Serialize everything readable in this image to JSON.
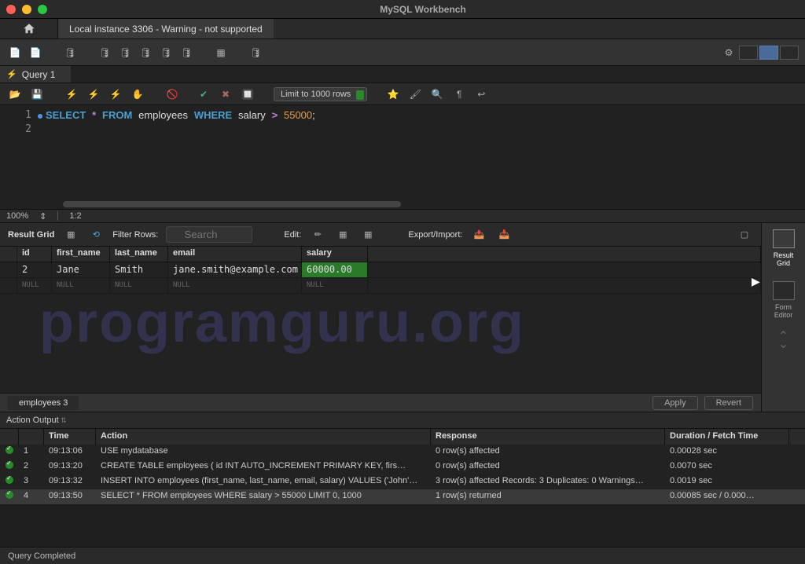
{
  "window": {
    "title": "MySQL Workbench"
  },
  "connection_tab": "Local instance 3306 - Warning - not supported",
  "query_tab": "Query 1",
  "limit_dropdown": "Limit to 1000 rows",
  "sql": {
    "line1": {
      "kw1": "SELECT",
      "star": "*",
      "kw2": "FROM",
      "tbl": "employees",
      "kw3": "WHERE",
      "col": "salary",
      "op": ">",
      "val": "55000",
      "semi": ";"
    }
  },
  "zoom": {
    "pct": "100%",
    "pos": "1:2"
  },
  "result_toolbar": {
    "title": "Result Grid",
    "filter_label": "Filter Rows:",
    "filter_placeholder": "Search",
    "edit_label": "Edit:",
    "export_label": "Export/Import:"
  },
  "grid": {
    "columns": [
      "id",
      "first_name",
      "last_name",
      "email",
      "salary"
    ],
    "rows": [
      {
        "id": "2",
        "first_name": "Jane",
        "last_name": "Smith",
        "email": "jane.smith@example.com",
        "salary": "60000.00"
      }
    ],
    "null_label": "NULL"
  },
  "result_tab": "employees 3",
  "buttons": {
    "apply": "Apply",
    "revert": "Revert"
  },
  "side": {
    "grid": "Result\nGrid",
    "form": "Form\nEditor"
  },
  "action_output": {
    "title": "Action Output",
    "columns": {
      "time": "Time",
      "action": "Action",
      "response": "Response",
      "duration": "Duration / Fetch Time"
    },
    "rows": [
      {
        "n": "1",
        "time": "09:13:06",
        "action": "USE mydatabase",
        "response": "0 row(s) affected",
        "duration": "0.00028 sec"
      },
      {
        "n": "2",
        "time": "09:13:20",
        "action": "CREATE TABLE employees (     id INT AUTO_INCREMENT PRIMARY KEY,     firs…",
        "response": "0 row(s) affected",
        "duration": "0.0070 sec"
      },
      {
        "n": "3",
        "time": "09:13:32",
        "action": "INSERT INTO employees (first_name, last_name, email, salary) VALUES ('John'…",
        "response": "3 row(s) affected Records: 3  Duplicates: 0  Warnings…",
        "duration": "0.0019 sec"
      },
      {
        "n": "4",
        "time": "09:13:50",
        "action": "SELECT * FROM employees WHERE salary > 55000 LIMIT 0, 1000",
        "response": "1 row(s) returned",
        "duration": "0.00085 sec / 0.000…"
      }
    ]
  },
  "status": "Query Completed",
  "watermark": "programguru.org"
}
